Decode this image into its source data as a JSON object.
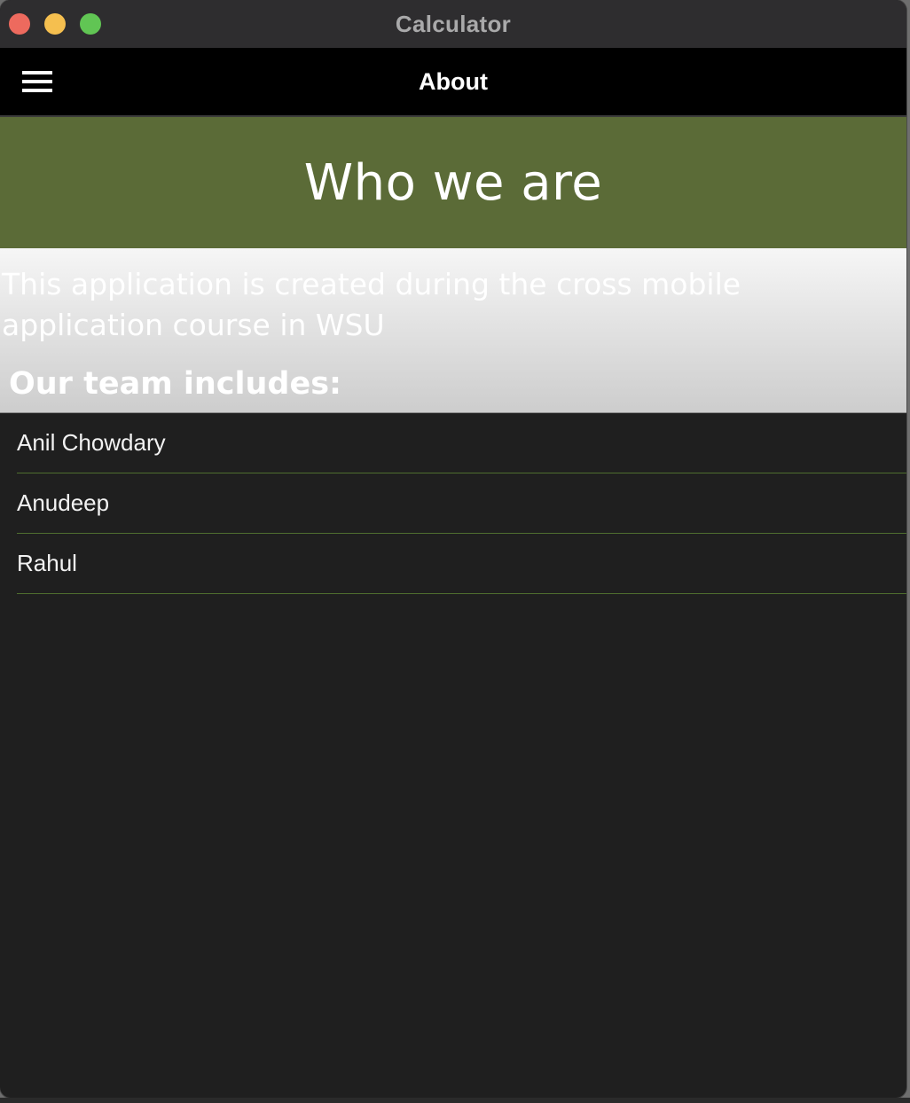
{
  "window": {
    "title": "Calculator"
  },
  "appbar": {
    "menu_icon": "hamburger-menu-icon",
    "title": "About"
  },
  "hero": {
    "title": "Who we are"
  },
  "intro": {
    "text": "This application is created during the cross mobile application course in WSU",
    "team_heading": "Our team includes:"
  },
  "team": [
    {
      "name": "Anil Chowdary"
    },
    {
      "name": "Anudeep"
    },
    {
      "name": "Rahul"
    }
  ],
  "colors": {
    "hero_background": "#5b6b37",
    "appbar_background": "#000000",
    "content_background": "#1f1f1f",
    "divider": "#4f6e2f",
    "close": "#ed6a5e",
    "minimize": "#f5bf4f",
    "maximize": "#61c554"
  }
}
